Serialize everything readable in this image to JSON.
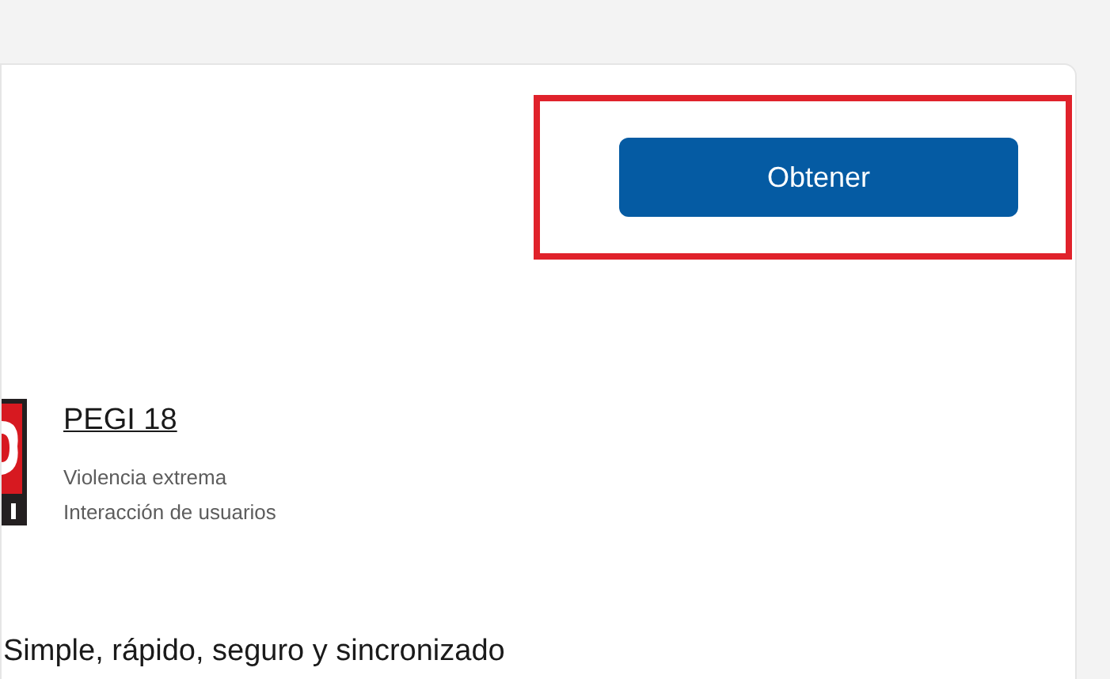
{
  "get_button": {
    "label": "Obtener",
    "highlighted": true
  },
  "rating": {
    "title": "PEGI 18",
    "descriptors": [
      "Violencia extrema",
      "Interacción de usuarios"
    ]
  },
  "description": "Simple, rápido, seguro y sincronizado"
}
